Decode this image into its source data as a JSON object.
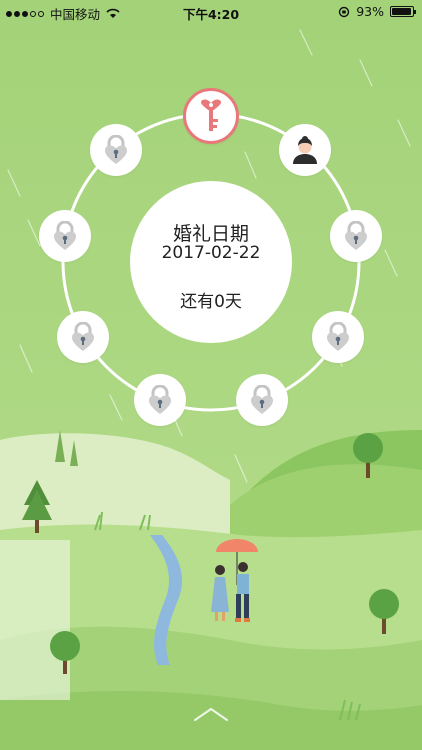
{
  "status_bar": {
    "carrier": "中国移动",
    "time": "下午4:20",
    "battery": "93%",
    "battery_level": 0.93
  },
  "lock_ring": {
    "active_node": "key-icon",
    "nodes": [
      "key-icon",
      "avatar-icon",
      "lock-icon",
      "lock-icon",
      "lock-icon",
      "lock-icon",
      "lock-icon",
      "lock-icon",
      "lock-icon",
      "lock-icon"
    ]
  },
  "center": {
    "title": "婚礼日期",
    "date": "2017-02-22",
    "countdown": "还有0天"
  },
  "colors": {
    "background": "#a6d47c",
    "key_accent": "#e8787a",
    "umbrella": "#f0856a"
  }
}
